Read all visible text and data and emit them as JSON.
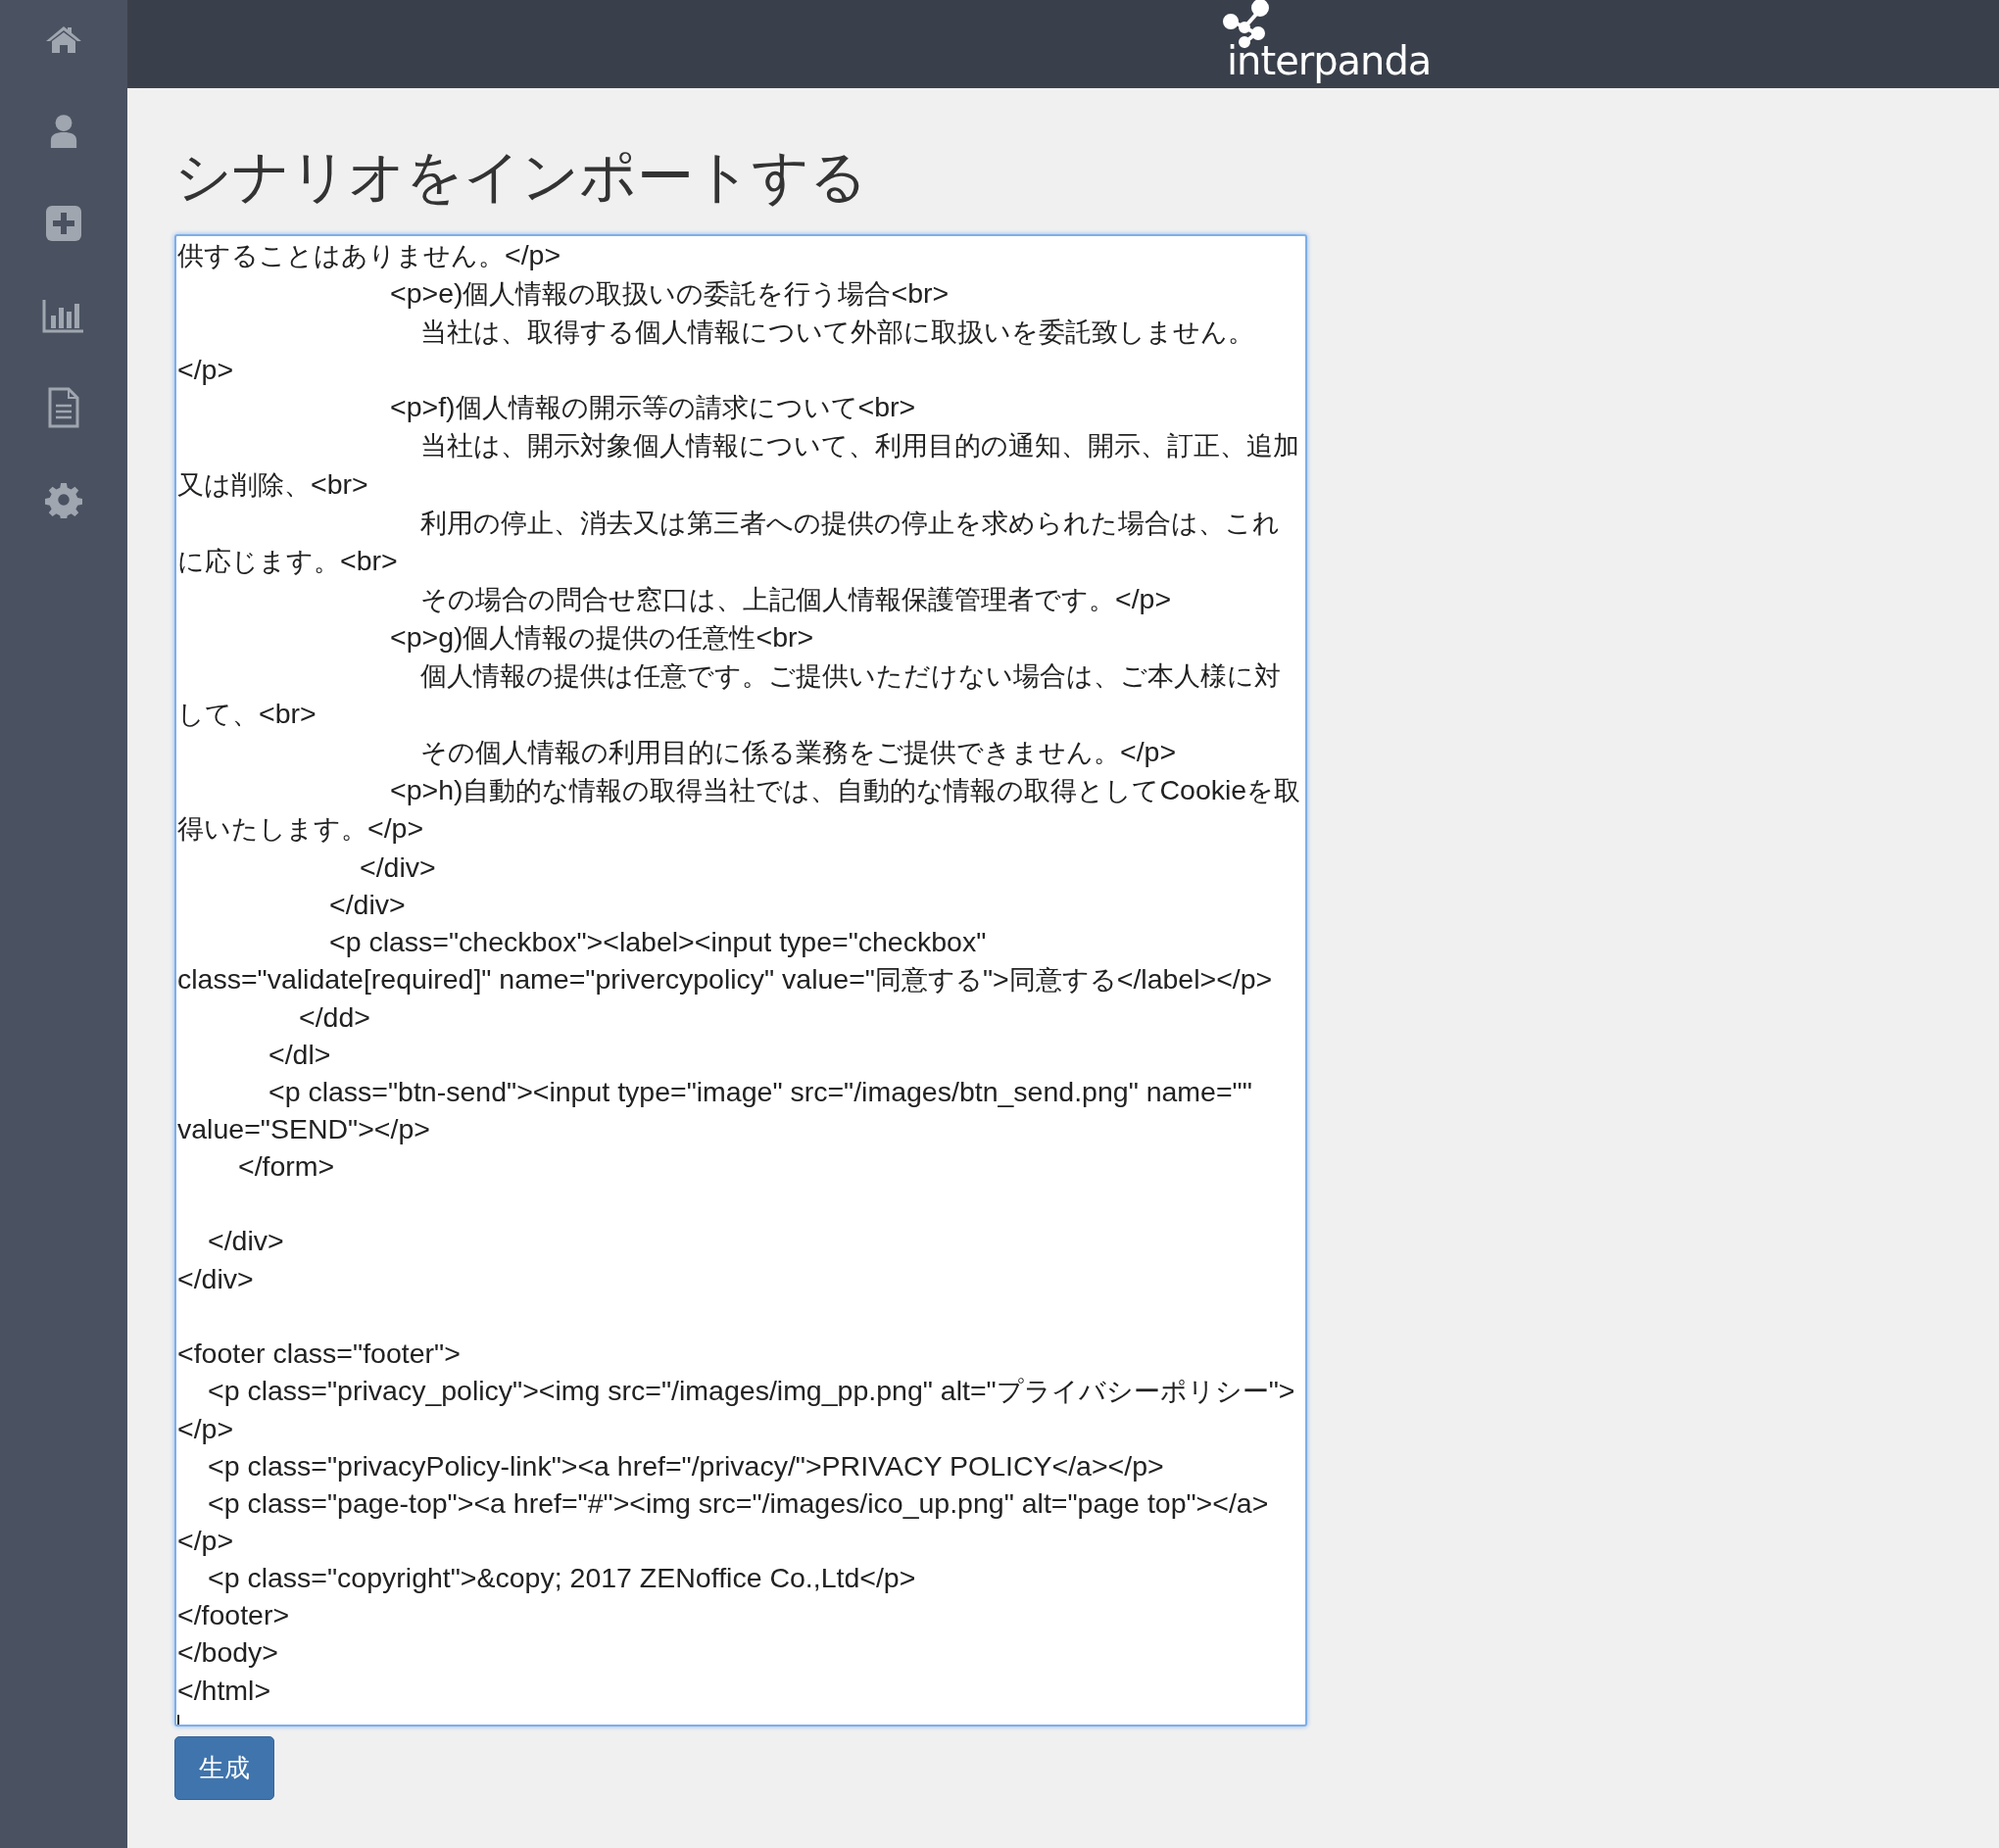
{
  "sidebar": {
    "items": [
      {
        "kind": "home"
      },
      {
        "kind": "user"
      },
      {
        "kind": "add"
      },
      {
        "kind": "chart"
      },
      {
        "kind": "document"
      },
      {
        "kind": "settings"
      }
    ]
  },
  "header": {
    "logo": "interpanda"
  },
  "page": {
    "title": "シナリオをインポートする"
  },
  "import_field": {
    "value": "供することはありません。</p>\n\t\t\t\t\t\t\t<p>e)個人情報の取扱いの委託を行う場合<br>\n\t\t\t\t\t\t\t\t当社は、取得する個人情報について外部に取扱いを委託致しません。</p>\n\t\t\t\t\t\t\t<p>f)個人情報の開示等の請求について<br>\n\t\t\t\t\t\t\t\t当社は、開示対象個人情報について、利用目的の通知、開示、訂正、追加又は削除、<br>\n\t\t\t\t\t\t\t\t利用の停止、消去又は第三者への提供の停止を求められた場合は、これに応じます。<br>\n\t\t\t\t\t\t\t\tその場合の問合せ窓口は、上記個人情報保護管理者です。</p>\n\t\t\t\t\t\t\t<p>g)個人情報の提供の任意性<br>\n\t\t\t\t\t\t\t\t個人情報の提供は任意です。ご提供いただけない場合は、ご本人様に対して、<br>\n\t\t\t\t\t\t\t\tその個人情報の利用目的に係る業務をご提供できません。</p>\n\t\t\t\t\t\t\t<p>h)自動的な情報の取得当社では、自動的な情報の取得としてCookieを取得いたします。</p>\n\t\t\t\t\t\t</div>\n\t\t\t\t\t</div>\n\t\t\t\t\t<p class=\"checkbox\"><label><input type=\"checkbox\"\nclass=\"validate[required]\" name=\"privercypolicy\" value=\"同意する\">同意する</label></p>\n\t\t\t\t</dd>\n\t\t\t</dl>\n\t\t\t<p class=\"btn-send\"><input type=\"image\" src=\"/images/btn_send.png\" name=\"\"\nvalue=\"SEND\"></p>\n\t\t</form>\n\n\t</div>\n</div>\n\n<footer class=\"footer\">\n\t<p class=\"privacy_policy\"><img src=\"/images/img_pp.png\" alt=\"プライバシーポリシー\"></p>\n\t<p class=\"privacyPolicy-link\"><a href=\"/privacy/\">PRIVACY POLICY</a></p>\n\t<p class=\"page-top\"><a href=\"#\"><img src=\"/images/ico_up.png\" alt=\"page top\"></a>\n</p>\n\t<p class=\"copyright\">&copy; 2017 ZENoffice Co.,Ltd</p>\n</footer>\n</body>\n</html>\n"
  },
  "generate_button": {
    "label": "生成"
  }
}
